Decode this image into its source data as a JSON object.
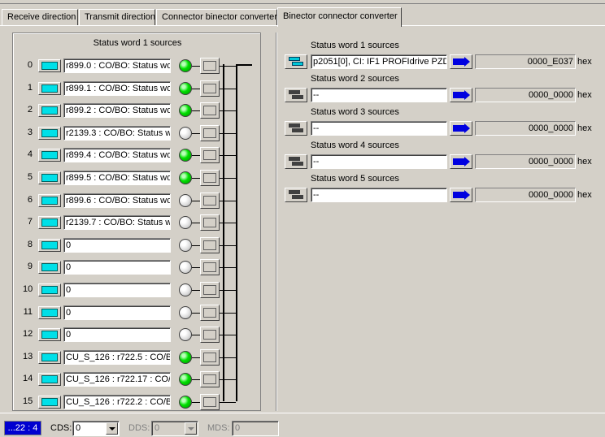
{
  "tabs": [
    {
      "label": "Receive direction"
    },
    {
      "label": "Transmit direction"
    },
    {
      "label": "Connector binector converter"
    },
    {
      "label": "Binector connector converter"
    }
  ],
  "left_panel": {
    "title": "Status word 1 sources",
    "rows": [
      {
        "index": "0",
        "value": "r899.0 : CO/BO: Status wo",
        "led": "on"
      },
      {
        "index": "1",
        "value": "r899.1 : CO/BO: Status wo",
        "led": "on"
      },
      {
        "index": "2",
        "value": "r899.2 : CO/BO: Status wo",
        "led": "on"
      },
      {
        "index": "3",
        "value": "r2139.3 : CO/BO: Status w",
        "led": "off"
      },
      {
        "index": "4",
        "value": "r899.4 : CO/BO: Status wo",
        "led": "on"
      },
      {
        "index": "5",
        "value": "r899.5 : CO/BO: Status wo",
        "led": "on"
      },
      {
        "index": "6",
        "value": "r899.6 : CO/BO: Status wo",
        "led": "off"
      },
      {
        "index": "7",
        "value": "r2139.7 : CO/BO: Status w",
        "led": "off"
      },
      {
        "index": "8",
        "value": "0",
        "led": "off"
      },
      {
        "index": "9",
        "value": "0",
        "led": "off"
      },
      {
        "index": "10",
        "value": "0",
        "led": "off"
      },
      {
        "index": "11",
        "value": "0",
        "led": "off"
      },
      {
        "index": "12",
        "value": "0",
        "led": "off"
      },
      {
        "index": "13",
        "value": "CU_S_126 : r722.5 : CO/B",
        "led": "on"
      },
      {
        "index": "14",
        "value": "CU_S_126 : r722.17 : CO/I",
        "led": "on"
      },
      {
        "index": "15",
        "value": "CU_S_126 : r722.2 : CO/B",
        "led": "on"
      }
    ]
  },
  "right_panel": {
    "sections": [
      {
        "label": "Status word 1 sources",
        "value": "p2051[0], CI: IF1 PROFIdrive PZD",
        "output": "0000_E037",
        "unit": "hex",
        "active": true
      },
      {
        "label": "Status word 2 sources",
        "value": "--",
        "output": "0000_0000",
        "unit": "hex",
        "active": false
      },
      {
        "label": "Status word 3 sources",
        "value": "--",
        "output": "0000_0000",
        "unit": "hex",
        "active": false
      },
      {
        "label": "Status word 4 sources",
        "value": "--",
        "output": "0000_0000",
        "unit": "hex",
        "active": false
      },
      {
        "label": "Status word 5 sources",
        "value": "--",
        "output": "0000_0000",
        "unit": "hex",
        "active": false
      }
    ]
  },
  "statusbar": {
    "id": "...22 : 4",
    "cds_label": "CDS:",
    "cds_value": "0",
    "dds_label": "DDS:",
    "dds_value": "0",
    "mds_label": "MDS:",
    "mds_value": "0"
  }
}
